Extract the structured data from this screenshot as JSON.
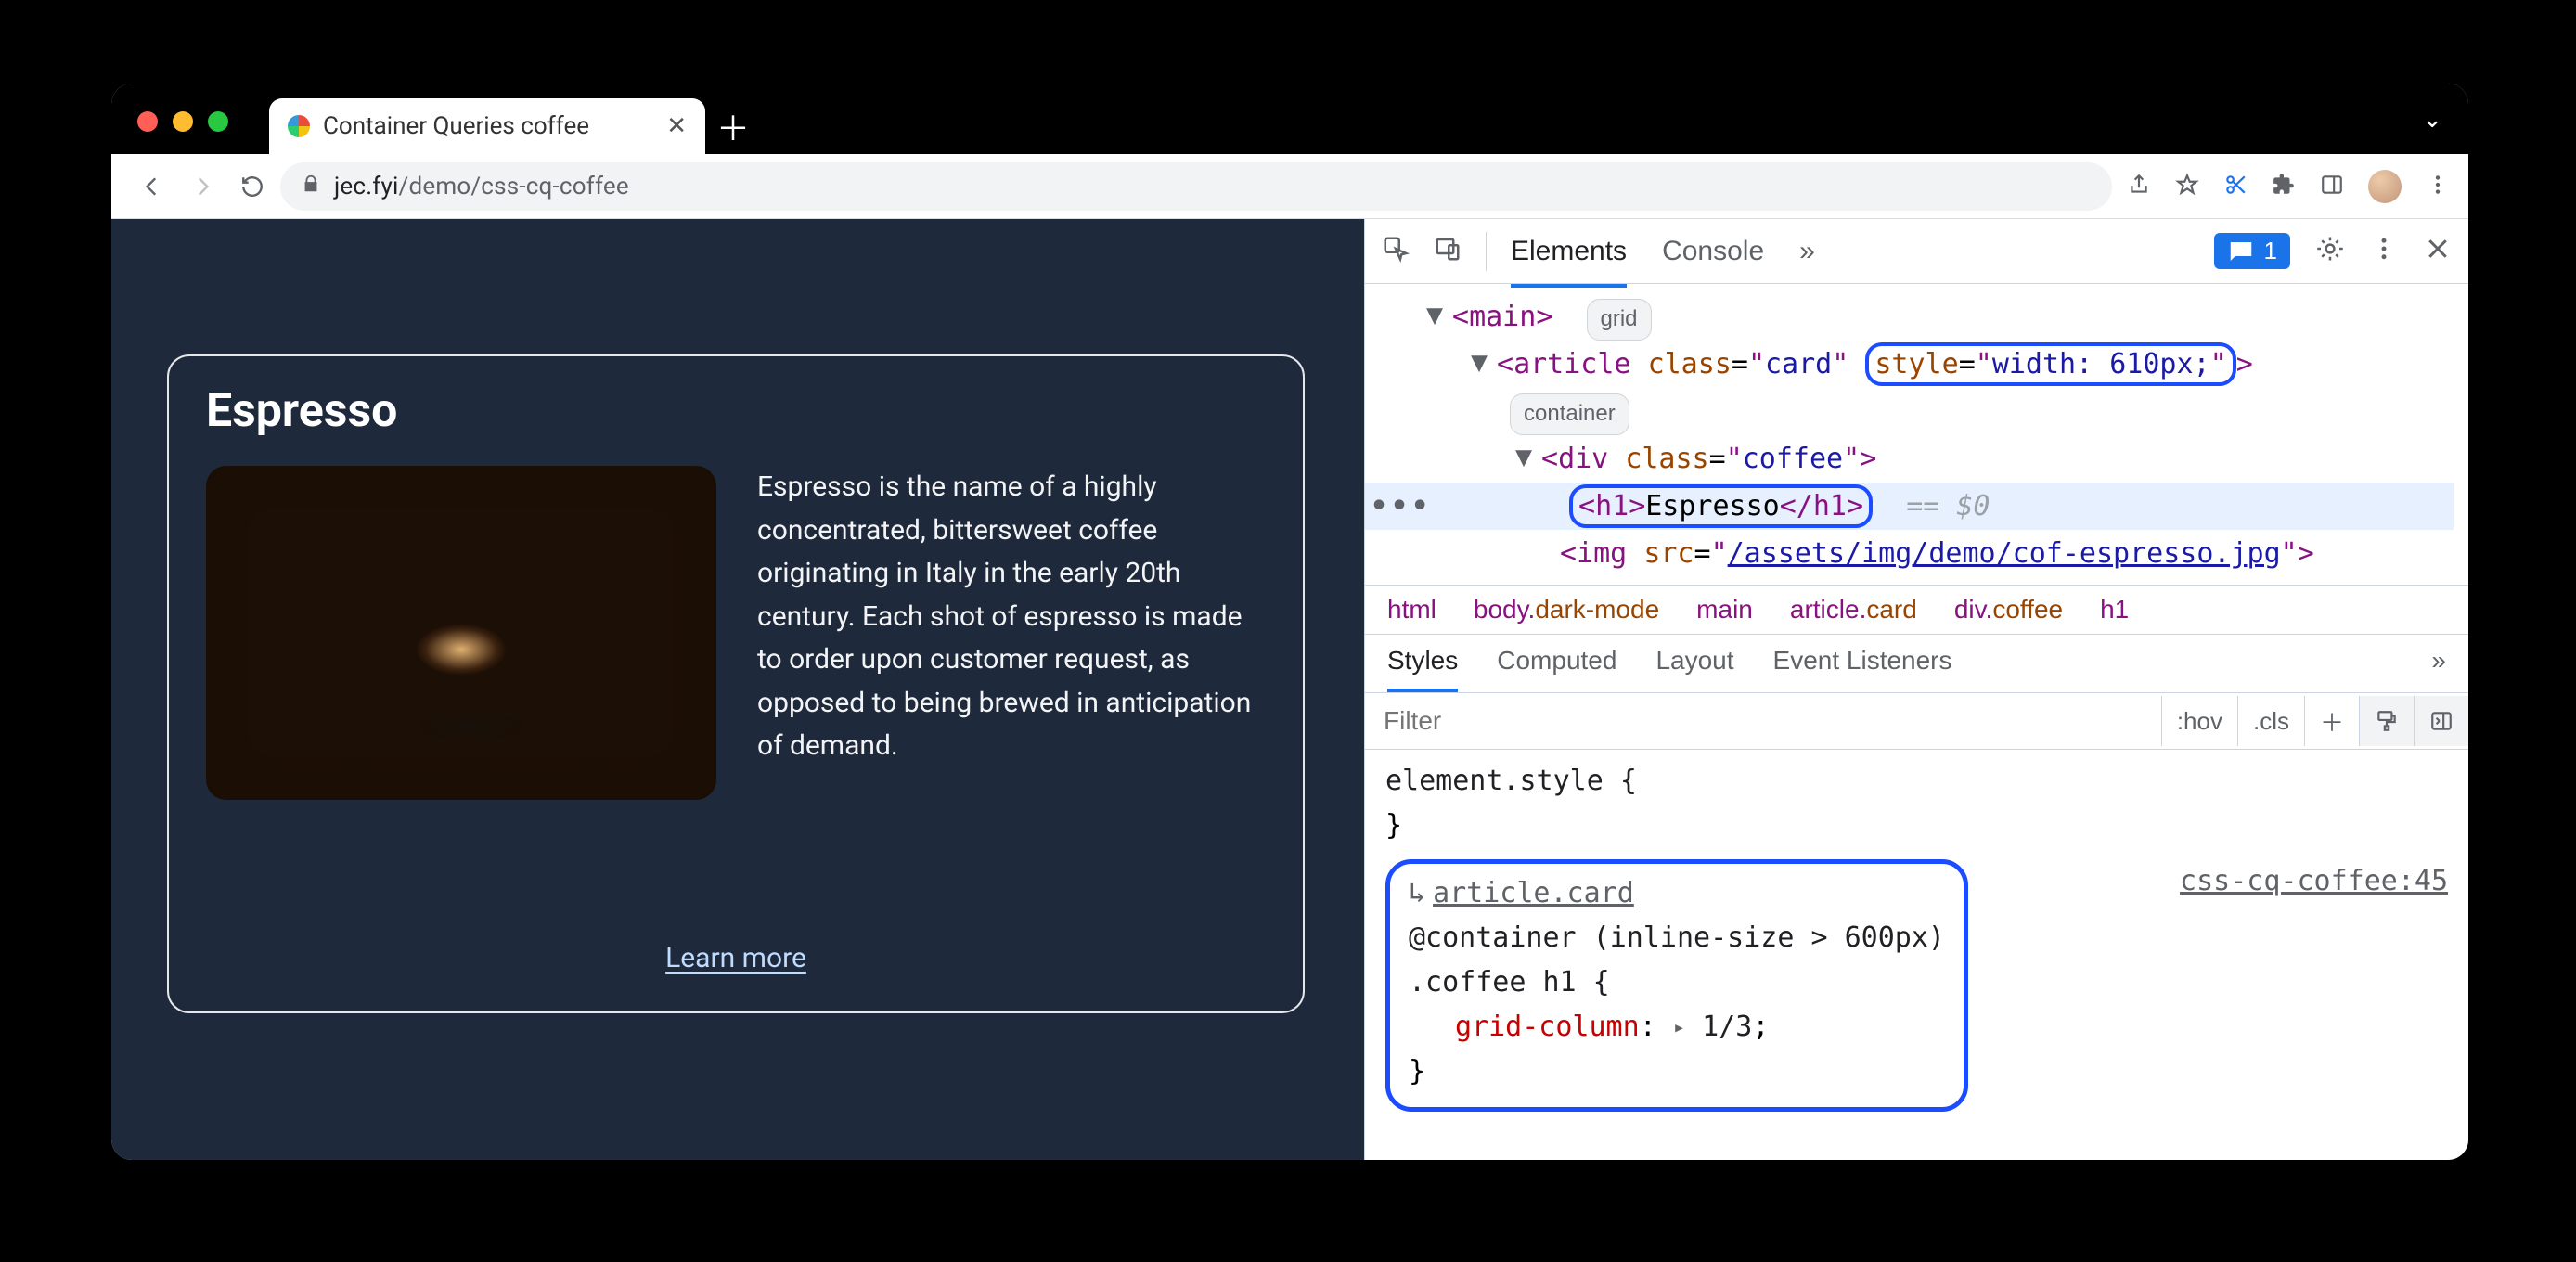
{
  "window": {
    "tab_title": "Container Queries coffee",
    "url_host": "jec.fyi",
    "url_path": "/demo/css-cq-coffee"
  },
  "page": {
    "card": {
      "title": "Espresso",
      "description": "Espresso is the name of a highly concentrated, bittersweet coffee originating in Italy in the early 20th century. Each shot of espresso is made to order upon customer request, as opposed to being brewed in anticipation of demand.",
      "link_label": "Learn more"
    }
  },
  "devtools": {
    "tabs": {
      "elements": "Elements",
      "console": "Console"
    },
    "issues_count": "1",
    "dom": {
      "main_badge": "grid",
      "article_class": "card",
      "article_style": "width: 610px;",
      "article_badge": "container",
      "div_class": "coffee",
      "h1_text": "Espresso",
      "sel_suffix": "== $0",
      "img_src": "/assets/img/demo/cof-espresso.jpg"
    },
    "breadcrumb": {
      "html": "html",
      "body": "body",
      "body_cls": "dark-mode",
      "main": "main",
      "article": "article",
      "article_cls": "card",
      "div": "div",
      "div_cls": "coffee",
      "h1": "h1"
    },
    "styles": {
      "tabs": {
        "styles": "Styles",
        "computed": "Computed",
        "layout": "Layout",
        "events": "Event Listeners"
      },
      "filter_placeholder": "Filter",
      "hov": ":hov",
      "cls": ".cls",
      "elementstyle": "element.style {",
      "brace_close": "}",
      "rule": {
        "article_link": "article.card",
        "container_line": "@container (inline-size > 600px)",
        "selector": ".coffee h1 {",
        "prop": "grid-column",
        "val": "1/3",
        "source": "css-cq-coffee:45"
      }
    }
  }
}
